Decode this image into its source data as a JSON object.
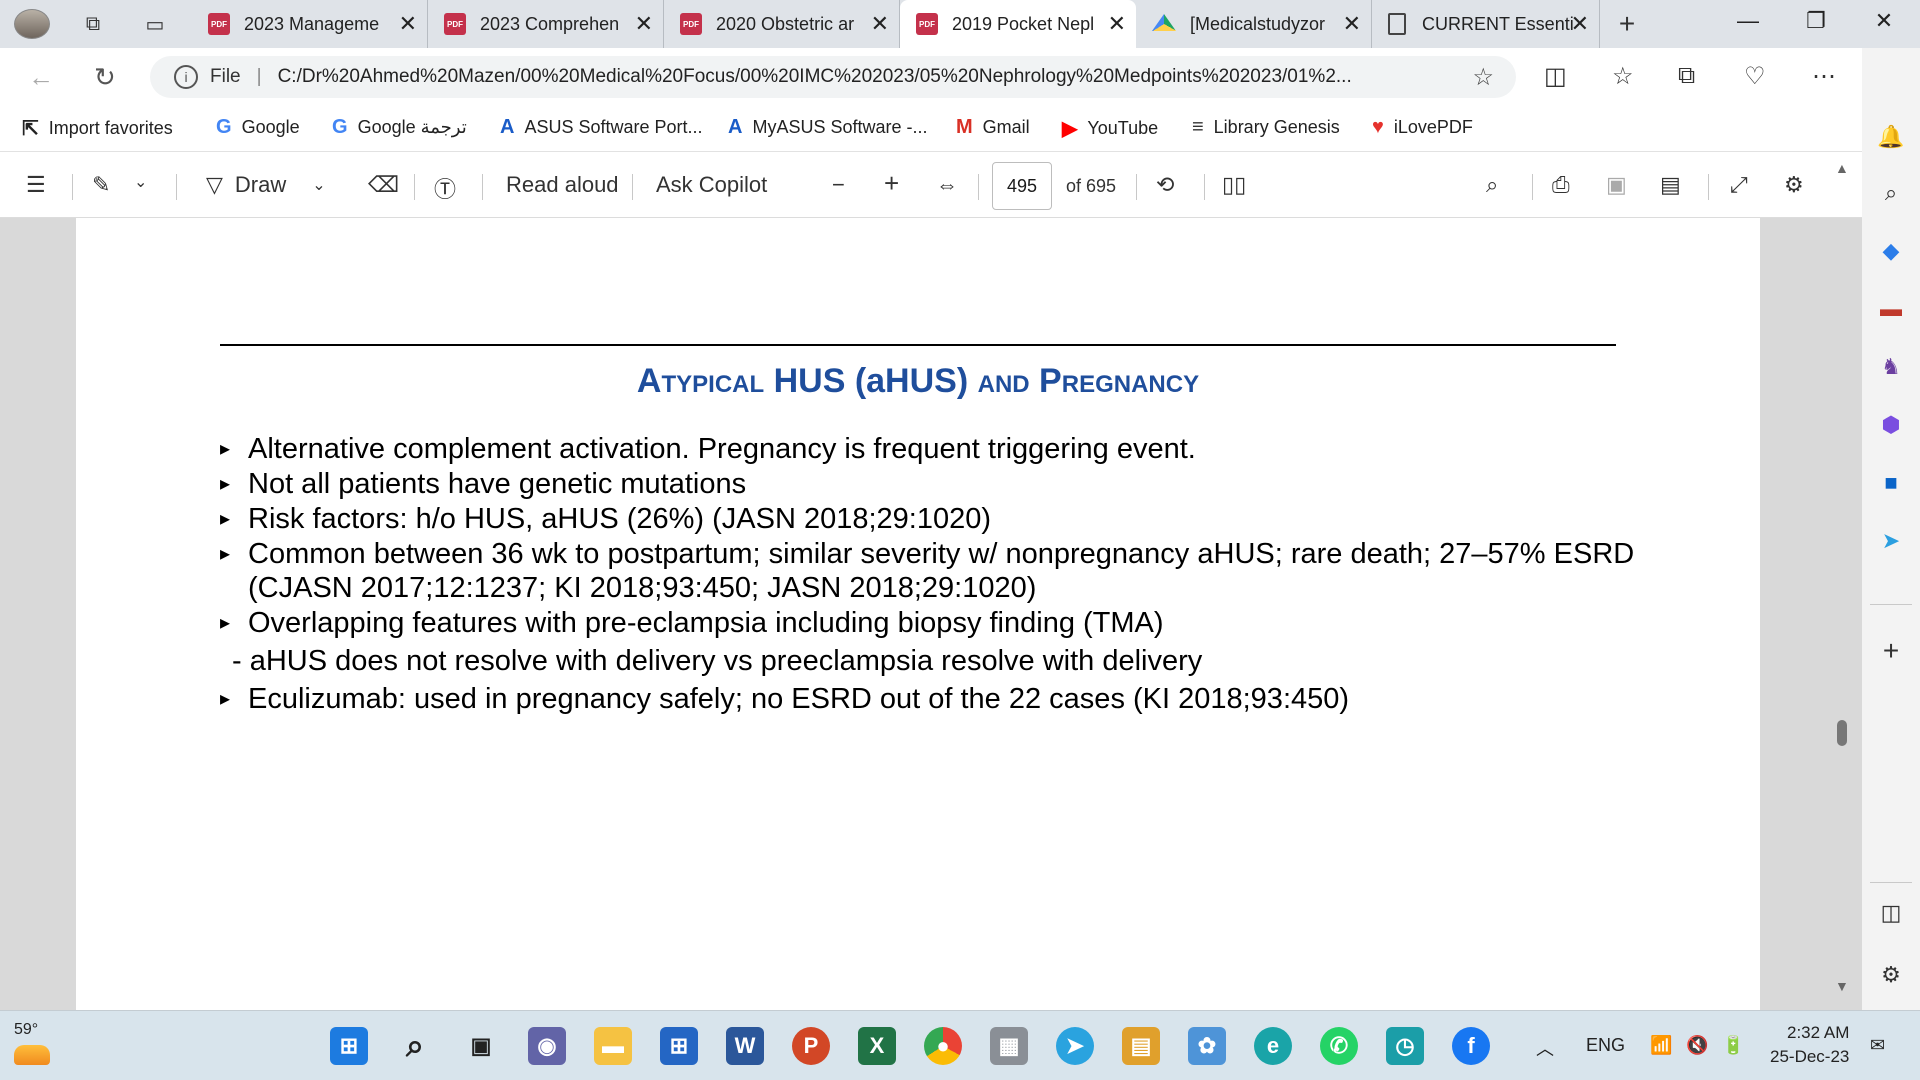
{
  "tabs": [
    {
      "label": "2023 Manageme",
      "icon": "pdf-icon"
    },
    {
      "label": "2023 Comprehen",
      "icon": "pdf-icon"
    },
    {
      "label": "2020 Obstetric ar",
      "icon": "pdf-icon"
    },
    {
      "label": "2019 Pocket Nepl",
      "icon": "pdf-icon",
      "active": true
    },
    {
      "label": "[Medicalstudyzor",
      "icon": "google-drive-icon"
    },
    {
      "label": "CURRENT Essenti",
      "icon": "document-icon"
    }
  ],
  "address": {
    "file_label": "File",
    "url": "C:/Dr%20Ahmed%20Mazen/00%20Medical%20Focus/00%20IMC%202023/05%20Nephrology%20Medpoints%202023/01%2..."
  },
  "favorites": [
    {
      "label": "Import favorites",
      "icon": "import-icon"
    },
    {
      "label": "Google",
      "icon": "google-icon"
    },
    {
      "label": "Google ترجمة",
      "icon": "google-translate-icon"
    },
    {
      "label": "ASUS Software Port...",
      "icon": "asus-icon"
    },
    {
      "label": "MyASUS Software -...",
      "icon": "asus-icon"
    },
    {
      "label": "Gmail",
      "icon": "gmail-icon"
    },
    {
      "label": "YouTube",
      "icon": "youtube-icon"
    },
    {
      "label": "Library Genesis",
      "icon": "libgen-icon"
    },
    {
      "label": "iLovePDF",
      "icon": "ilovepdf-icon"
    }
  ],
  "pdf_toolbar": {
    "draw_label": "Draw",
    "read_aloud_label": "Read aloud",
    "ask_copilot_label": "Ask Copilot",
    "page_number": "495",
    "page_total": "of 695"
  },
  "slide": {
    "title_parts": [
      "A",
      "TYPICAL",
      " HUS (aHUS) ",
      "AND",
      " P",
      "REGNANCY"
    ],
    "bullets": [
      "Alternative complement activation. Pregnancy is frequent triggering event.",
      "Not all patients have genetic mutations",
      "Risk factors: h/o HUS, aHUS (26%) (JASN 2018;29:1020)",
      "Common between 36 wk to postpartum; similar severity w/ nonpregnancy aHUS; rare death; 27–57% ESRD (CJASN 2017;12:1237; KI 2018;93:450; JASN 2018;29:1020)",
      "Overlapping features with pre-eclampsia including biopsy finding (TMA)"
    ],
    "sub_bullet": "- aHUS does not resolve with delivery vs preeclampsia resolve with delivery",
    "last_bullet": "Eculizumab: used in pregnancy safely; no ESRD out of the 22 cases (KI 2018;93:450)"
  },
  "taskbar": {
    "weather_temp": "59°",
    "language": "ENG",
    "time": "2:32 AM",
    "date": "25-Dec-23"
  },
  "colors": {
    "title_blue": "#1f4e9c",
    "taskbar_bg": "#d8e4ec",
    "pdf_red": "#c4314b"
  }
}
